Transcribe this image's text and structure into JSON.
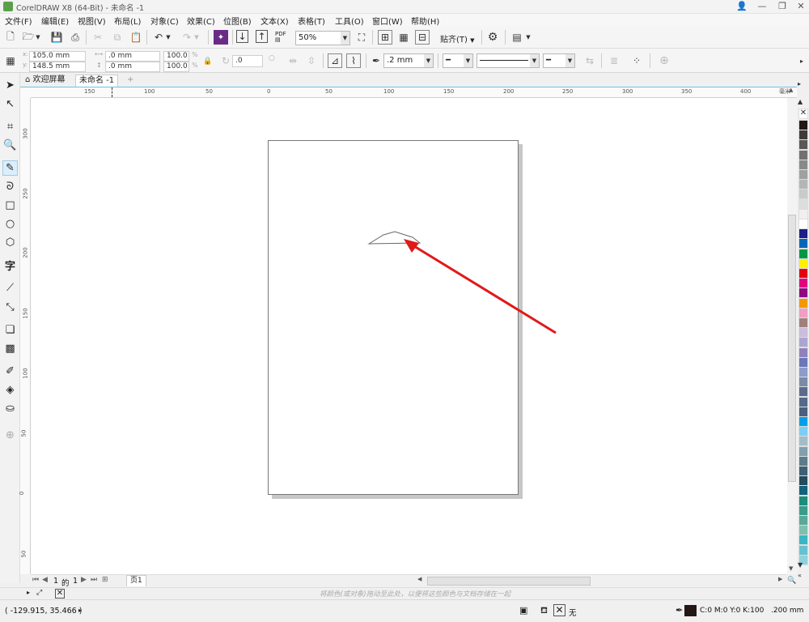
{
  "window": {
    "title": "CorelDRAW X8 (64-Bit) - 未命名 -1"
  },
  "menu": [
    "文件(F)",
    "编辑(E)",
    "视图(V)",
    "布局(L)",
    "对象(C)",
    "效果(C)",
    "位图(B)",
    "文本(X)",
    "表格(T)",
    "工具(O)",
    "窗口(W)",
    "帮助(H)"
  ],
  "standard_toolbar": {
    "zoom": "50%",
    "snap_label": "贴齐(T)",
    "pdf_label": "PDF"
  },
  "property_bar": {
    "x": "105.0 mm",
    "y": "148.5 mm",
    "width": ".0 mm",
    "height": ".0 mm",
    "scale_w": "100.0",
    "scale_h": "100.0",
    "percent": "%",
    "rotation": ".0",
    "outline_width": ".2 mm"
  },
  "tabs": {
    "welcome": "欢迎屏幕",
    "document": "未命名 -1"
  },
  "rulers": {
    "h_labels": [
      "150",
      "100",
      "50",
      "0",
      "50",
      "100",
      "150",
      "200",
      "250",
      "300",
      "350",
      "400"
    ],
    "v_labels": [
      "300",
      "250",
      "200",
      "150",
      "100",
      "50",
      "0",
      "50"
    ],
    "unit": "毫米"
  },
  "page_nav": {
    "current": "1",
    "of": "的",
    "total": "1",
    "page_tab": "页1"
  },
  "hint": "将颜色(或对象)拖动至此处，以便将这些颜色与文档存储在一起",
  "status": {
    "coordinates": "( -129.915, 35.466 )",
    "fill_label": "无",
    "outline_color": "C:0 M:0 Y:0 K:100",
    "outline_width": ".200 mm"
  },
  "palette": [
    "#231815",
    "#3e3a39",
    "#595757",
    "#727171",
    "#898989",
    "#9fa0a0",
    "#b5b5b6",
    "#c9caca",
    "#dcdddd",
    "#efefef",
    "#ffffff",
    "#1d2088",
    "#0068b7",
    "#009944",
    "#fff100",
    "#e60012",
    "#e4007f",
    "#920783",
    "#f39800",
    "#f19ec2",
    "#a0807d",
    "#c9bedc",
    "#aaa6cf",
    "#8f82bc",
    "#6a78b8",
    "#8c9bcb",
    "#7b8aa7",
    "#5b6b8c",
    "#556a8a",
    "#4c5f7d",
    "#00a0e9",
    "#7ecef4",
    "#a3bcc9",
    "#80a0ae",
    "#5c7c8a",
    "#3e6073",
    "#274a5c",
    "#15607a",
    "#1c8c7c",
    "#399c8a",
    "#5aa897",
    "#7ec0b0",
    "#3ab5c4",
    "#67c1d1",
    "#8fd1dc"
  ],
  "colors": {
    "accent": "#6cc4ea",
    "arrow": "#e01a1a"
  }
}
